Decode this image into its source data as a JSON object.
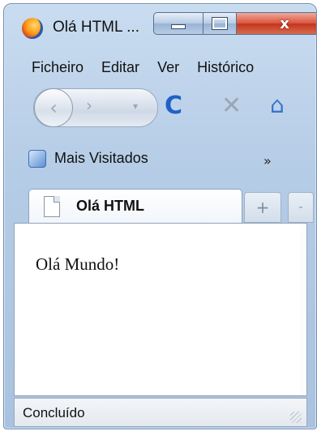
{
  "window": {
    "title": "Olá HTML ...",
    "close_glyph": "x"
  },
  "menu": {
    "items": [
      "Ficheiro",
      "Editar",
      "Ver",
      "Histórico"
    ]
  },
  "navigation": {
    "back_glyph": "‹",
    "forward_glyph": "›",
    "dropdown_glyph": "▾",
    "reload_glyph": "C",
    "stop_glyph": "✕",
    "home_glyph": "⌂"
  },
  "bookmarks": {
    "label": "Mais Visitados",
    "overflow_glyph": "»"
  },
  "tabs": {
    "active_label": "Olá HTML",
    "new_tab_glyph": "+",
    "list_glyph": "-"
  },
  "content": {
    "text": "Olá Mundo!"
  },
  "status": {
    "text": "Concluído"
  },
  "colors": {
    "accent_reload": "#1e62c7",
    "close_button": "#c3351d",
    "chrome": "#b5cce6"
  }
}
